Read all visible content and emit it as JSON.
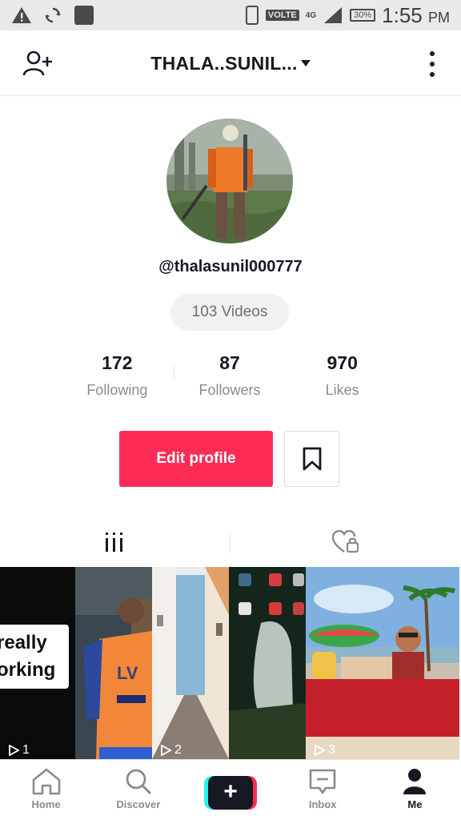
{
  "status_bar": {
    "icons": [
      "warning-icon",
      "sync-icon",
      "app-icon",
      "phone-icon"
    ],
    "volte": "VOLTE",
    "network": "4G",
    "battery": "30%",
    "time": "1:55",
    "ampm": "PM"
  },
  "header": {
    "title": "THALA..SUNIL...",
    "add_user_icon": "add-user-icon",
    "more_icon": "more-vertical-icon"
  },
  "profile": {
    "handle": "@thalasunil000777",
    "videos_pill": "103 Videos",
    "stats": [
      {
        "value": "172",
        "label": "Following"
      },
      {
        "value": "87",
        "label": "Followers"
      },
      {
        "value": "970",
        "label": "Likes"
      }
    ],
    "edit_profile_label": "Edit profile"
  },
  "tabs": [
    {
      "icon": "videos-grid-icon"
    },
    {
      "icon": "liked-private-icon"
    }
  ],
  "videos": [
    {
      "caption_line1": "really",
      "caption_line2": "orking",
      "views": "1"
    },
    {
      "caption_line1": "",
      "caption_line2": "",
      "views": ""
    },
    {
      "caption_line1": "",
      "caption_line2": "",
      "views": "2"
    },
    {
      "caption_line1": "",
      "caption_line2": "",
      "views": ""
    },
    {
      "caption_line1": "",
      "caption_line2": "",
      "views": "3"
    }
  ],
  "bottom_nav": [
    {
      "label": "Home",
      "icon": "home-icon"
    },
    {
      "label": "Discover",
      "icon": "search-icon"
    },
    {
      "label": "",
      "icon": "plus-icon"
    },
    {
      "label": "Inbox",
      "icon": "inbox-icon"
    },
    {
      "label": "Me",
      "icon": "profile-icon"
    }
  ],
  "colors": {
    "accent": "#fe2c55",
    "cyan": "#25f4ee",
    "text": "#161823",
    "muted": "#8a8b91"
  }
}
